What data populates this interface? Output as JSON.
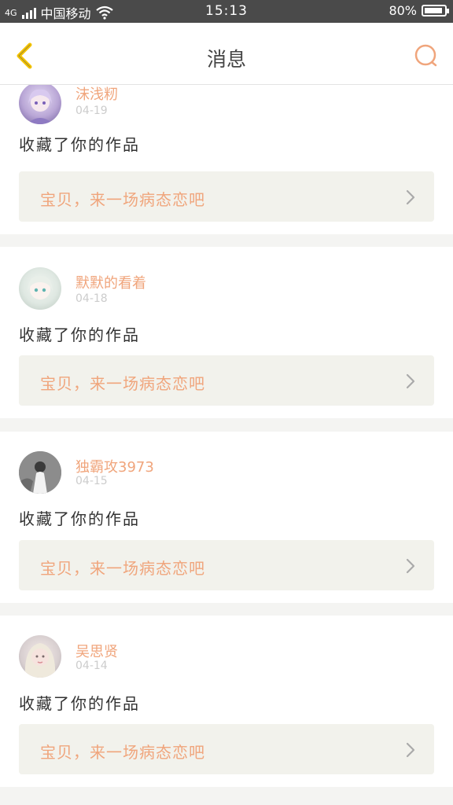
{
  "status_bar": {
    "network": "4G",
    "carrier": "中国移动",
    "time": "15:13",
    "battery": "80%",
    "icons": [
      "signal-icon",
      "wifi-icon",
      "battery-icon"
    ]
  },
  "header": {
    "title": "消息",
    "back_icon": "chevron-left-icon",
    "search_icon": "search-icon"
  },
  "colors": {
    "accent": "#f0a57c",
    "back_arrow": "#f5c400",
    "card_box": "#f2f2ec",
    "divider": "#f4f4f2"
  },
  "messages": [
    {
      "username": "沫浅籾",
      "date": "04-19",
      "action": "收藏了你的作品",
      "work_title": "宝贝，来一场病态恋吧"
    },
    {
      "username": "默默的看着",
      "date": "04-18",
      "action": "收藏了你的作品",
      "work_title": "宝贝，来一场病态恋吧"
    },
    {
      "username": "独霸攻3973",
      "date": "04-15",
      "action": "收藏了你的作品",
      "work_title": "宝贝，来一场病态恋吧"
    },
    {
      "username": "吴思贤",
      "date": "04-14",
      "action": "收藏了你的作品",
      "work_title": "宝贝，来一场病态恋吧"
    }
  ]
}
